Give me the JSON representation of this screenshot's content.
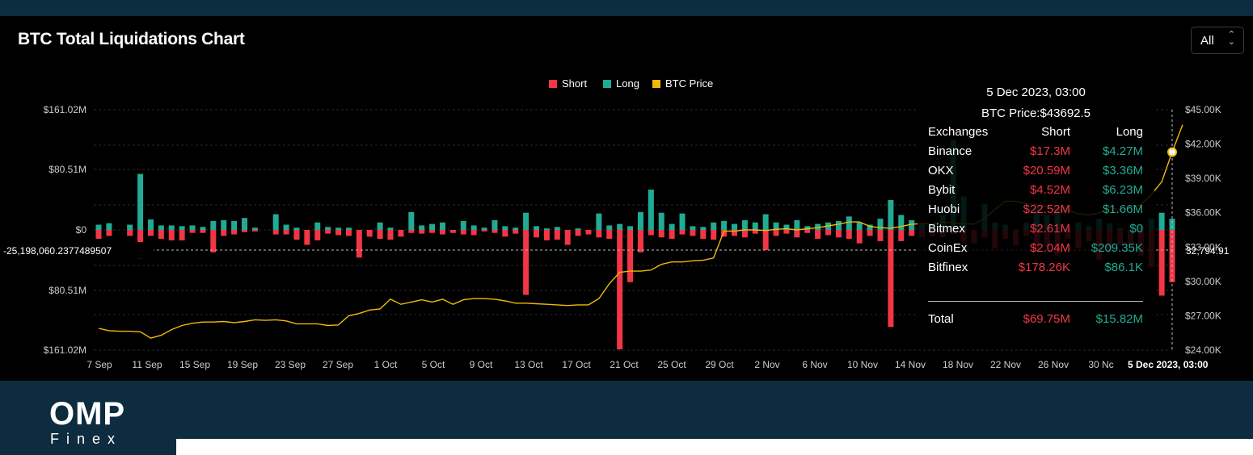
{
  "header": {
    "title": "BTC Total Liquidations Chart",
    "range": "All",
    "range_arrows": "⌃⌄"
  },
  "colors": {
    "short": "#f23645",
    "long": "#22ab94",
    "price": "#f0b90b",
    "background": "#000000",
    "band": "#0e2c40"
  },
  "chart_data": {
    "type": "bar",
    "title": "BTC Total Liquidations Chart",
    "legend": {
      "position": "top-center",
      "items": [
        "Short",
        "Long",
        "BTC Price"
      ]
    },
    "left_axis": {
      "ticks": [
        "$161.02M",
        "$80.51M",
        "$0",
        "$80.51M",
        "$161.02M"
      ],
      "range": [
        -161.02,
        161.02
      ],
      "unit": "M USD"
    },
    "right_axis": {
      "ticks": [
        "$45.00K",
        "$42.00K",
        "$39.00K",
        "$36.00K",
        "$33.00K",
        "$30.00K",
        "$27.00K",
        "$24.00K"
      ],
      "range": [
        24000,
        45000
      ]
    },
    "crosshair": {
      "left_label": "-25,198,060.2377489507",
      "right_label": "32,794.91",
      "x_label": "5 Dec 2023, 03:00"
    },
    "x_tick_labels": [
      "7 Sep",
      "11 Sep",
      "15 Sep",
      "19 Sep",
      "23 Sep",
      "27 Sep",
      "1 Oct",
      "5 Oct",
      "9 Oct",
      "13 Oct",
      "17 Oct",
      "21 Oct",
      "25 Oct",
      "29 Oct",
      "2 Nov",
      "6 Nov",
      "10 Nov",
      "14 Nov",
      "18 Nov",
      "22 Nov",
      "26 Nov",
      "30 Nc"
    ],
    "series": [
      {
        "name": "Long",
        "values": [
          7,
          9,
          0,
          7,
          75,
          14,
          6,
          6,
          5,
          6,
          4,
          12,
          13,
          12,
          16,
          3,
          0,
          21,
          7,
          3,
          0,
          10,
          4,
          3,
          3,
          0,
          0,
          10,
          3,
          0,
          24,
          6,
          8,
          10,
          0,
          12,
          6,
          3,
          13,
          5,
          3,
          23,
          5,
          2,
          4,
          0,
          2,
          0,
          22,
          6,
          8,
          5,
          24,
          54,
          23,
          8,
          22,
          5,
          4,
          10,
          12,
          8,
          13,
          10,
          21,
          10,
          7,
          13,
          5,
          8,
          10,
          12,
          18,
          10,
          7,
          15,
          40,
          20,
          13,
          9,
          9,
          20,
          120,
          45,
          0,
          35,
          10,
          7,
          0,
          10,
          30,
          20,
          30,
          2,
          10,
          5,
          15,
          9,
          3,
          0,
          5,
          15,
          23,
          15
        ]
      },
      {
        "name": "Short",
        "values": [
          -12,
          -8,
          0,
          -8,
          -38,
          -8,
          -12,
          -14,
          -14,
          -4,
          -4,
          -30,
          -8,
          -6,
          -3,
          -2,
          0,
          -6,
          -6,
          -13,
          -20,
          -14,
          -5,
          -7,
          -8,
          -37,
          -9,
          -12,
          -13,
          -9,
          -4,
          -5,
          -4,
          -6,
          -4,
          -6,
          -7,
          -2,
          -4,
          -9,
          -5,
          -87,
          -10,
          -14,
          -13,
          -20,
          -8,
          -6,
          -10,
          -12,
          -160,
          -70,
          -30,
          -7,
          -10,
          -12,
          -6,
          -8,
          -12,
          -13,
          -9,
          -8,
          -10,
          -5,
          -27,
          -8,
          -5,
          -10,
          -4,
          -12,
          -7,
          -10,
          -12,
          -18,
          -8,
          -15,
          -130,
          -15,
          -8,
          -10,
          -9,
          -10,
          -6,
          -15,
          -18,
          -10,
          -25,
          -12,
          -20,
          -8,
          -30,
          -22,
          -35,
          -12,
          -25,
          -15,
          -40,
          -30,
          -20,
          -18,
          -35,
          -50,
          -88,
          -70
        ]
      },
      {
        "name": "BTC Price",
        "values": [
          25900,
          25700,
          25650,
          25650,
          25600,
          25050,
          25300,
          25800,
          26150,
          26350,
          26450,
          26450,
          26500,
          26400,
          26500,
          26650,
          26600,
          26650,
          26550,
          26300,
          26300,
          26300,
          26150,
          26200,
          27000,
          27200,
          27500,
          27600,
          28450,
          28000,
          28200,
          28400,
          28200,
          28450,
          28000,
          28400,
          28500,
          28500,
          28450,
          28300,
          28100,
          28100,
          28050,
          28000,
          27950,
          27900,
          27950,
          27950,
          28500,
          29800,
          30800,
          30900,
          30900,
          31000,
          31500,
          31700,
          31700,
          31800,
          31850,
          32050,
          34400,
          34400,
          34500,
          34500,
          34450,
          34550,
          34600,
          34500,
          34600,
          34700,
          34850,
          35000,
          35200,
          35200,
          34800,
          34700,
          34650,
          34800,
          35000,
          35050,
          35050,
          35200,
          35100,
          35050,
          35000,
          35500,
          36300,
          37000,
          37000,
          36800,
          36700,
          36500,
          36200,
          36250,
          35900,
          35800,
          36000,
          36500,
          36200,
          36500,
          36700,
          37600,
          38700,
          41300,
          43692.5
        ]
      }
    ]
  },
  "tooltip": {
    "date": "5 Dec 2023, 03:00",
    "price_line": "BTC Price:$43692.5",
    "headers": [
      "Exchanges",
      "Short",
      "Long"
    ],
    "rows": [
      {
        "exchange": "Binance",
        "short": "$17.3M",
        "long": "$4.27M"
      },
      {
        "exchange": "OKX",
        "short": "$20.59M",
        "long": "$3.36M"
      },
      {
        "exchange": "Bybit",
        "short": "$4.52M",
        "long": "$6.23M"
      },
      {
        "exchange": "Huobi",
        "short": "$22.52M",
        "long": "$1.66M"
      },
      {
        "exchange": "Bitmex",
        "short": "$2.61M",
        "long": "$0"
      },
      {
        "exchange": "CoinEx",
        "short": "$2.04M",
        "long": "$209.35K"
      },
      {
        "exchange": "Bitfinex",
        "short": "$178.26K",
        "long": "$86.1K"
      }
    ],
    "total": {
      "label": "Total",
      "short": "$69.75M",
      "long": "$15.82M"
    }
  },
  "logo": {
    "main": "OMP",
    "sub": "Finex"
  }
}
